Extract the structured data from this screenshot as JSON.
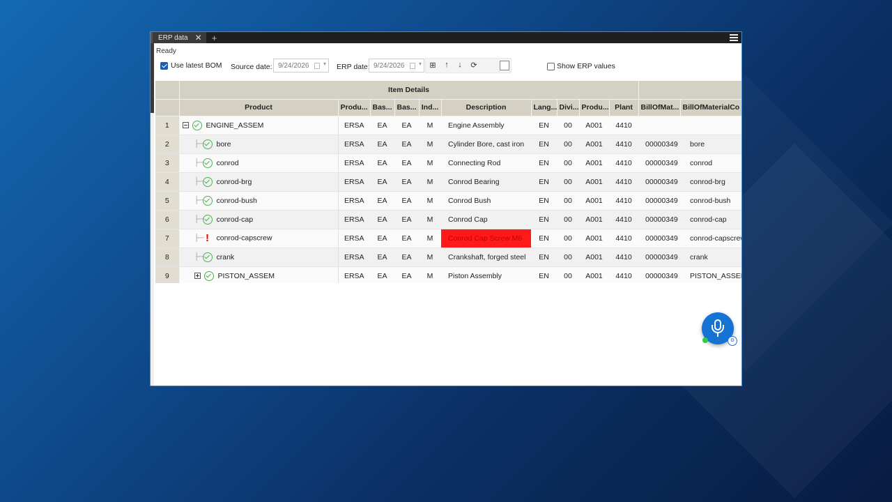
{
  "tab": {
    "title": "ERP data",
    "close": "✕",
    "add": "+"
  },
  "status": "Ready",
  "toolbar": {
    "use_latest_bom_label": "Use latest BOM",
    "use_latest_bom_checked": true,
    "source_date_label": "Source date:",
    "source_date_value": "9/24/2026",
    "erp_date_label": "ERP date:",
    "erp_date_value": "9/24/2026",
    "icons": [
      "grid-icon",
      "arrow-up-icon",
      "arrow-down-icon",
      "refresh-icon"
    ],
    "icon_glyphs": [
      "⊞",
      "↑",
      "↓",
      "⟳"
    ],
    "show_erp_values_label": "Show ERP values",
    "show_erp_values_checked": false
  },
  "grid": {
    "group_header": "Item Details",
    "columns": [
      "Product",
      "Produ...",
      "Bas...",
      "Bas...",
      "Ind...",
      "Description",
      "Lang...",
      "Divi...",
      "Produ...",
      "Plant",
      "BillOfMat...",
      "BillOfMaterialCo"
    ],
    "rows": [
      {
        "num": "1",
        "product": "ENGINE_ASSEM",
        "level": 0,
        "expander": "minus",
        "status": "ok",
        "c1": "ERSA",
        "c2": "EA",
        "c3": "EA",
        "c4": "M",
        "desc": "Engine Assembly",
        "lang": "EN",
        "div": "00",
        "prod": "A001",
        "plant": "4410",
        "bom": "",
        "bomc": ""
      },
      {
        "num": "2",
        "product": "bore",
        "level": 1,
        "status": "ok",
        "c1": "ERSA",
        "c2": "EA",
        "c3": "EA",
        "c4": "M",
        "desc": "Cylinder Bore, cast iron",
        "lang": "EN",
        "div": "00",
        "prod": "A001",
        "plant": "4410",
        "bom": "00000349",
        "bomc": "bore"
      },
      {
        "num": "3",
        "product": "conrod",
        "level": 1,
        "status": "ok",
        "c1": "ERSA",
        "c2": "EA",
        "c3": "EA",
        "c4": "M",
        "desc": "Connecting Rod",
        "lang": "EN",
        "div": "00",
        "prod": "A001",
        "plant": "4410",
        "bom": "00000349",
        "bomc": "conrod"
      },
      {
        "num": "4",
        "product": "conrod-brg",
        "level": 1,
        "status": "ok",
        "c1": "ERSA",
        "c2": "EA",
        "c3": "EA",
        "c4": "M",
        "desc": "Conrod Bearing",
        "lang": "EN",
        "div": "00",
        "prod": "A001",
        "plant": "4410",
        "bom": "00000349",
        "bomc": "conrod-brg"
      },
      {
        "num": "5",
        "product": "conrod-bush",
        "level": 1,
        "status": "ok",
        "c1": "ERSA",
        "c2": "EA",
        "c3": "EA",
        "c4": "M",
        "desc": "Conrod Bush",
        "lang": "EN",
        "div": "00",
        "prod": "A001",
        "plant": "4410",
        "bom": "00000349",
        "bomc": "conrod-bush"
      },
      {
        "num": "6",
        "product": "conrod-cap",
        "level": 1,
        "status": "ok",
        "c1": "ERSA",
        "c2": "EA",
        "c3": "EA",
        "c4": "M",
        "desc": "Conrod Cap",
        "lang": "EN",
        "div": "00",
        "prod": "A001",
        "plant": "4410",
        "bom": "00000349",
        "bomc": "conrod-cap"
      },
      {
        "num": "7",
        "product": "conrod-capscrew",
        "level": 1,
        "status": "warn",
        "c1": "ERSA",
        "c2": "EA",
        "c3": "EA",
        "c4": "M",
        "desc": "Conrod Cap Screw M6",
        "desc_alert": true,
        "lang": "EN",
        "div": "00",
        "prod": "A001",
        "plant": "4410",
        "bom": "00000349",
        "bomc": "conrod-capscrew"
      },
      {
        "num": "8",
        "product": "crank",
        "level": 1,
        "status": "ok",
        "c1": "ERSA",
        "c2": "EA",
        "c3": "EA",
        "c4": "M",
        "desc": "Crankshaft, forged steel",
        "lang": "EN",
        "div": "00",
        "prod": "A001",
        "plant": "4410",
        "bom": "00000349",
        "bomc": "crank"
      },
      {
        "num": "9",
        "product": "PISTON_ASSEM",
        "level": 1,
        "expander": "plus",
        "status": "ok",
        "c1": "ERSA",
        "c2": "EA",
        "c3": "EA",
        "c4": "M",
        "desc": "Piston Assembly",
        "lang": "EN",
        "div": "00",
        "prod": "A001",
        "plant": "4410",
        "bom": "00000349",
        "bomc": "PISTON_ASSEM"
      }
    ]
  },
  "colors": {
    "accent": "#1a5fb4",
    "alert": "#ff1a1a",
    "ok": "#4caf50",
    "header": "#d4d0c4"
  }
}
